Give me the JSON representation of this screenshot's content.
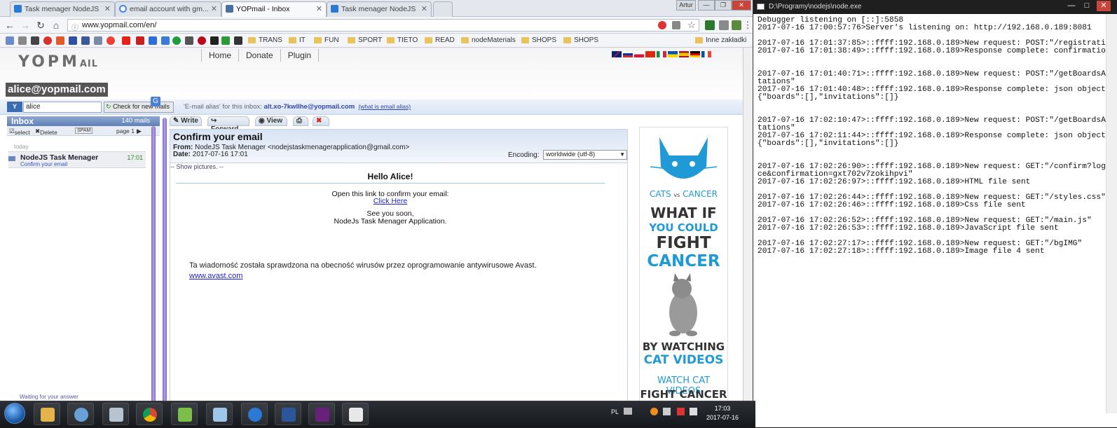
{
  "browser": {
    "tabs": [
      {
        "title": "Task menager NodeJS",
        "active": false
      },
      {
        "title": "email account with gm...",
        "active": false
      },
      {
        "title": "YOPmail - Inbox",
        "active": true
      },
      {
        "title": "Task menager NodeJS",
        "active": false
      }
    ],
    "window_label": "Artur",
    "url": "www.yopmail.com/en/",
    "bookmarks": [
      "TRANS",
      "IT",
      "FUN",
      "SPORT",
      "TIETO",
      "READ",
      "nodeMaterials",
      "SHOPS",
      "SHOPS"
    ],
    "other_bookmarks": "Inne zakładki"
  },
  "yopmail": {
    "logo_main": "YOPM",
    "logo_small": "AIL",
    "nav": [
      "Home",
      "Donate",
      "Plugin"
    ],
    "address": "alice@yopmail.com",
    "login_value": "alice",
    "check_button": "Check for new mails",
    "alias_prefix": "'E-mail alias' for this inbox:",
    "alias_email": "alt.xo-7kwllhe@yopmail.com",
    "alias_help": "(what is email alias)",
    "inbox": {
      "title": "Inbox",
      "count": "140 mails",
      "select": "select",
      "delete": "Delete",
      "spam": "SPAM",
      "page": "page 1",
      "day": "today",
      "mail": {
        "from": "NodeJS Task Menager",
        "subject": "Confirm your email",
        "time": "17:01"
      },
      "waiting": "Waiting for your answer"
    },
    "read_tabs": [
      "Write",
      "Forward",
      "View"
    ],
    "message": {
      "subject": "Confirm your email",
      "from_label": "From:",
      "from": "NodeJS Task Menager <nodejstaskmenagerapplication@gmail.com>",
      "date_label": "Date:",
      "date": "2017-07-16 17:01",
      "encoding_label": "Encoding:",
      "encoding": "worldwide (utf-8)",
      "show_pictures": "-- Show pictures. --",
      "hello": "Hello Alice!",
      "line1": "Open this link to confirm your email:",
      "link": "Click Here",
      "line2": "See you soon,",
      "line3": "NodeJs Task Menager Application.",
      "avast_note": "Ta wiadomość została sprawdzona na obecność wirusów przez oprogramowanie antywirusowe Avast.",
      "avast_link": "www.avast.com"
    },
    "ad": {
      "brand_a": "CATS",
      "brand_vs": "vs",
      "brand_b": "CANCER",
      "l1": "WHAT IF",
      "l2": "YOU COULD",
      "l3": "FIGHT",
      "l4": "CANCER",
      "l5": "BY WATCHING",
      "l6": "CAT VIDEOS",
      "l7": "WATCH CAT VIDEOS",
      "l8": "FIGHT CANCER"
    }
  },
  "console": {
    "title": "D:\\Programy\\nodejs\\node.exe",
    "lines": [
      "Debugger listening on [::]:5858",
      "2017-07-16 17:00:57:76>Server's listening on: http://192.168.0.189:8081",
      "",
      "2017-07-16 17:01:37:85>::ffff:192.168.0.189>New request: POST:\"/registration\"",
      "2017-07-16 17:01:38:49>::ffff:192.168.0.189>Response complete: confirmation",
      "",
      "",
      "2017-07-16 17:01:40:71>::ffff:192.168.0.189>New request: POST:\"/getBoardsAndInvi",
      "tations\"",
      "2017-07-16 17:01:40:48>::ffff:192.168.0.189>Response complete: json object:",
      "{\"boards\":[],\"invitations\":[]}",
      "",
      "",
      "2017-07-16 17:02:10:47>::ffff:192.168.0.189>New request: POST:\"/getBoardsAndInvi",
      "tations\"",
      "2017-07-16 17:02:11:44>::ffff:192.168.0.189>Response complete: json object:",
      "{\"boards\":[],\"invitations\":[]}",
      "",
      "",
      "2017-07-16 17:02:26:90>::ffff:192.168.0.189>New request: GET:\"/confirm?login=ali",
      "ce&confirmation=gxt702v7zokihpvi\"",
      "2017-07-16 17:02:26:97>::ffff:192.168.0.189>HTML file sent",
      "",
      "2017-07-16 17:02:26:44>::ffff:192.168.0.189>New request: GET:\"/styles.css\"",
      "2017-07-16 17:02:26:46>::ffff:192.168.0.189>Css file sent",
      "",
      "2017-07-16 17:02:26:52>::ffff:192.168.0.189>New request: GET:\"/main.js\"",
      "2017-07-16 17:02:26:53>::ffff:192.168.0.189>JavaScript file sent",
      "",
      "2017-07-16 17:02:27:17>::ffff:192.168.0.189>New request: GET:\"/bgIMG\"",
      "2017-07-16 17:02:27:18>::ffff:192.168.0.189>Image file 4 sent"
    ]
  },
  "taskbar": {
    "lang": "PL",
    "time": "17:03",
    "date": "2017-07-16"
  },
  "colors": {
    "accent": "#3b6cb3",
    "console_bg": "#ffffff",
    "taskbar": "#1f2328"
  }
}
